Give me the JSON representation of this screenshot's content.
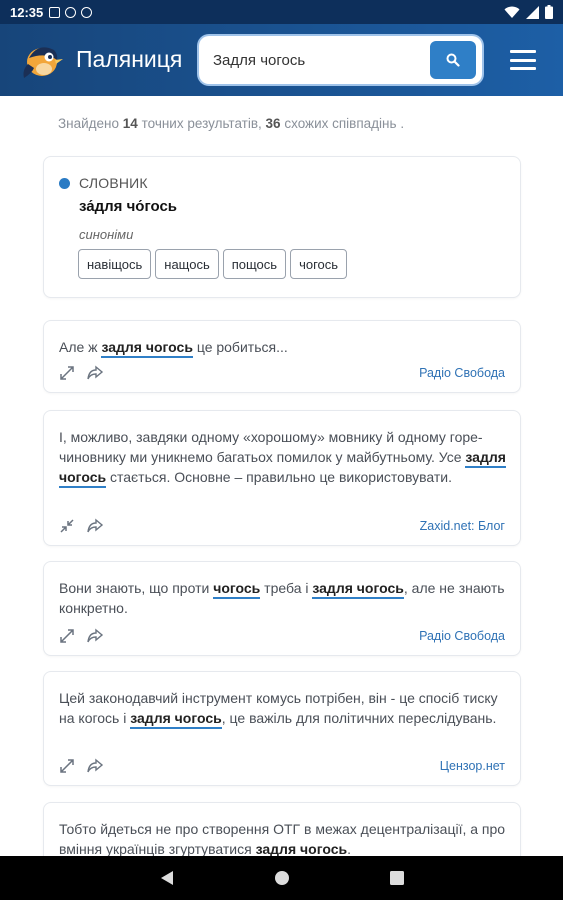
{
  "status_bar": {
    "time": "12:35"
  },
  "app": {
    "title": "Паляниця",
    "search_value": "Задля чогось"
  },
  "results_info": {
    "prefix": "Знайдено",
    "exact_count": "14",
    "exact_text": "точних результатів,",
    "similar_count": "36",
    "similar_text": "схожих співпадінь",
    "suffix": "."
  },
  "dictionary": {
    "label": "СЛОВНИК",
    "word": "за́для чо́гось",
    "synonyms_label": "синоніми",
    "synonyms": [
      "навіщось",
      "нащось",
      "пощось",
      "чогось"
    ]
  },
  "examples": [
    {
      "parts": [
        {
          "t": "Але ж ",
          "s": "plain"
        },
        {
          "t": "задля чогось",
          "s": "hl"
        },
        {
          "t": " це робиться...",
          "s": "plain"
        }
      ],
      "source": "Радіо Свобода",
      "expand_icon": "expand-icon"
    },
    {
      "parts": [
        {
          "t": "І, можливо, завдяки одному «хорошому» мовнику й одному горе-чиновнику ми уникнемо багатьох помилок у майбутньому. Усе ",
          "s": "plain"
        },
        {
          "t": "задля чогось",
          "s": "hl"
        },
        {
          "t": " стається. Основне – правильно це використовувати.",
          "s": "plain"
        }
      ],
      "source": "Zaxid.net: Блог",
      "expand_icon": "collapse-icon"
    },
    {
      "parts": [
        {
          "t": "Вони знають, що проти ",
          "s": "plain"
        },
        {
          "t": "чогось",
          "s": "hl"
        },
        {
          "t": " треба і ",
          "s": "plain"
        },
        {
          "t": "задля чогось",
          "s": "hl"
        },
        {
          "t": ", але не знають конкретно.",
          "s": "plain"
        }
      ],
      "source": "Радіо Свобода",
      "expand_icon": "expand-icon"
    },
    {
      "parts": [
        {
          "t": "Цей законодавчий інструмент комусь потрібен, він - це спосіб тиску на когось і ",
          "s": "plain"
        },
        {
          "t": "задля чогось",
          "s": "hl"
        },
        {
          "t": ", це важіль для політичних переслідувань.",
          "s": "plain"
        }
      ],
      "source": "Цензор.нет",
      "expand_icon": "expand-icon"
    },
    {
      "parts": [
        {
          "t": "Тобто йдеться не про створення ОТГ в межах децентралізації, а про вміння українців згуртуватися ",
          "s": "plain"
        },
        {
          "t": "задля чогось",
          "s": "hlb"
        },
        {
          "t": ".",
          "s": "plain"
        }
      ],
      "source": "",
      "expand_icon": "expand-icon"
    }
  ],
  "colors": {
    "header": "#1d5fa6",
    "accent": "#2f7fc7",
    "source_link": "#2f72b5"
  }
}
